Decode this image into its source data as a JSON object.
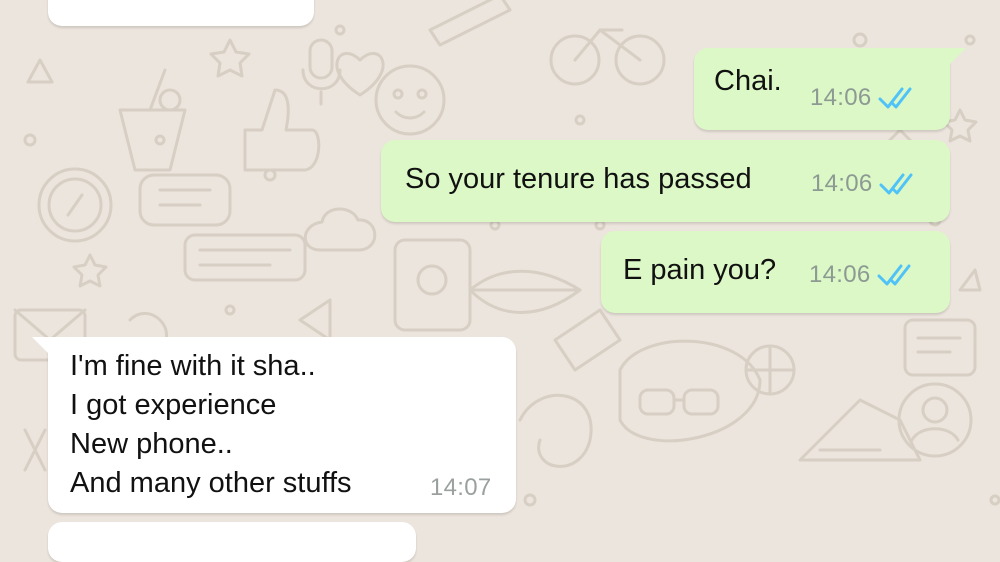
{
  "chat": {
    "colors": {
      "wallpaper": "#ece5dd",
      "doodle": "#d7cfc3",
      "outgoing_bubble": "#dcf8c6",
      "incoming_bubble": "#ffffff",
      "read_tick": "#4fc3f7",
      "timestamp": "#8d9a93"
    },
    "messages": [
      {
        "direction": "incoming",
        "text": "",
        "time": "",
        "status": ""
      },
      {
        "direction": "outgoing",
        "text": "Chai.",
        "time": "14:06",
        "status": "read"
      },
      {
        "direction": "outgoing",
        "text": "So your tenure has passed",
        "time": "14:06",
        "status": "read"
      },
      {
        "direction": "outgoing",
        "text": "E pain you?",
        "time": "14:06",
        "status": "read"
      },
      {
        "direction": "incoming",
        "text": "I'm fine with it sha..\nI got experience\nNew phone..\nAnd many other stuffs",
        "time": "14:07",
        "status": ""
      },
      {
        "direction": "incoming",
        "text": "",
        "time": "",
        "status": ""
      }
    ]
  }
}
